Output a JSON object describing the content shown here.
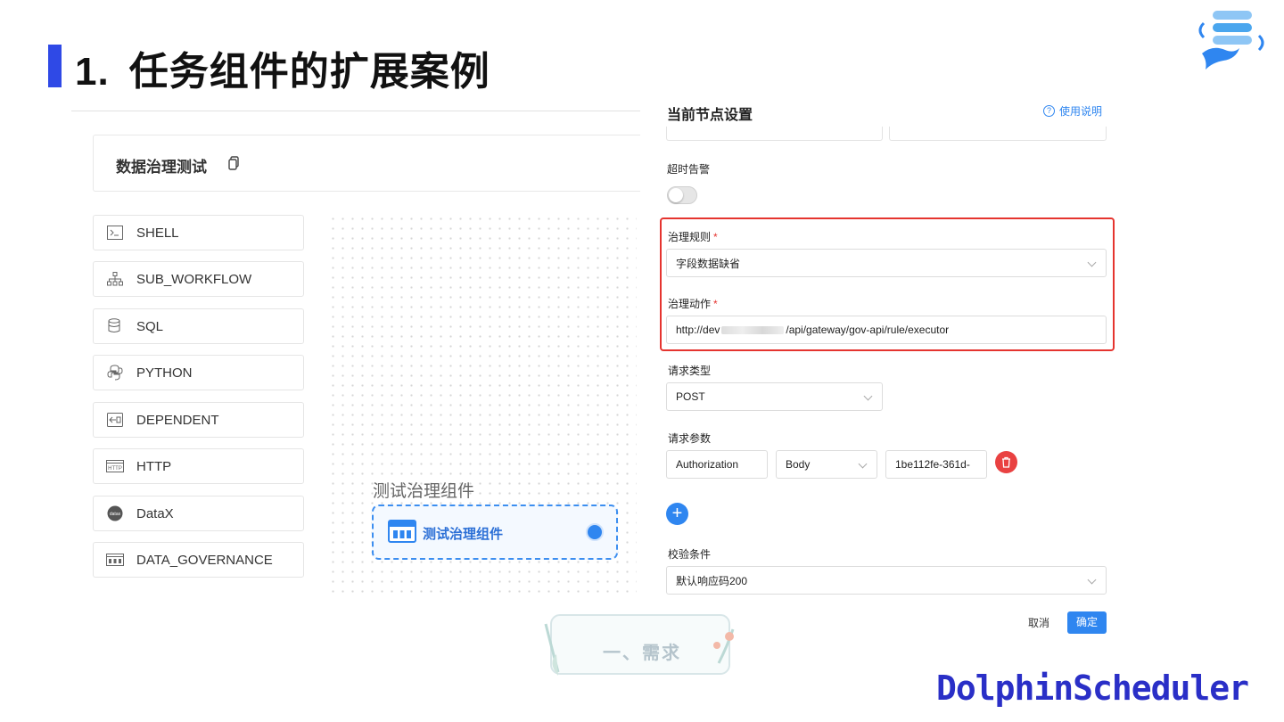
{
  "slide": {
    "number": "1.",
    "title": "任务组件的扩展案例",
    "brand": "DolphinScheduler"
  },
  "workflow": {
    "name": "数据治理测试"
  },
  "palette": [
    {
      "label": "SHELL",
      "icon": "terminal-icon"
    },
    {
      "label": "SUB_WORKFLOW",
      "icon": "hierarchy-icon"
    },
    {
      "label": "SQL",
      "icon": "database-icon"
    },
    {
      "label": "PYTHON",
      "icon": "python-icon"
    },
    {
      "label": "DEPENDENT",
      "icon": "dependent-icon"
    },
    {
      "label": "HTTP",
      "icon": "http-icon"
    },
    {
      "label": "DataX",
      "icon": "datax-icon"
    },
    {
      "label": "DATA_GOVERNANCE",
      "icon": "governance-icon"
    }
  ],
  "canvas": {
    "node_title": "测试治理组件",
    "node_label": "测试治理组件"
  },
  "drawer": {
    "title": "当前节点设置",
    "help": "使用说明",
    "timeout_label": "超时告警",
    "rule_label": "治理规则",
    "rule_value": "字段数据缺省",
    "action_label": "治理动作",
    "action_value_prefix": "http://dev",
    "action_value_suffix": "/api/gateway/gov-api/rule/executor",
    "request_type_label": "请求类型",
    "request_type_value": "POST",
    "params_label": "请求参数",
    "param_key": "Authorization",
    "param_location": "Body",
    "param_value": "1be112fe-361d-",
    "check_label": "校验条件",
    "check_value": "默认响应码200",
    "cancel": "取消",
    "confirm": "确定"
  },
  "stamp": {
    "text": "一、需求"
  },
  "colors": {
    "accent": "#2f86f0",
    "title_bar": "#2f49e6",
    "danger": "#e5342f",
    "brand": "#2a2fc7"
  }
}
